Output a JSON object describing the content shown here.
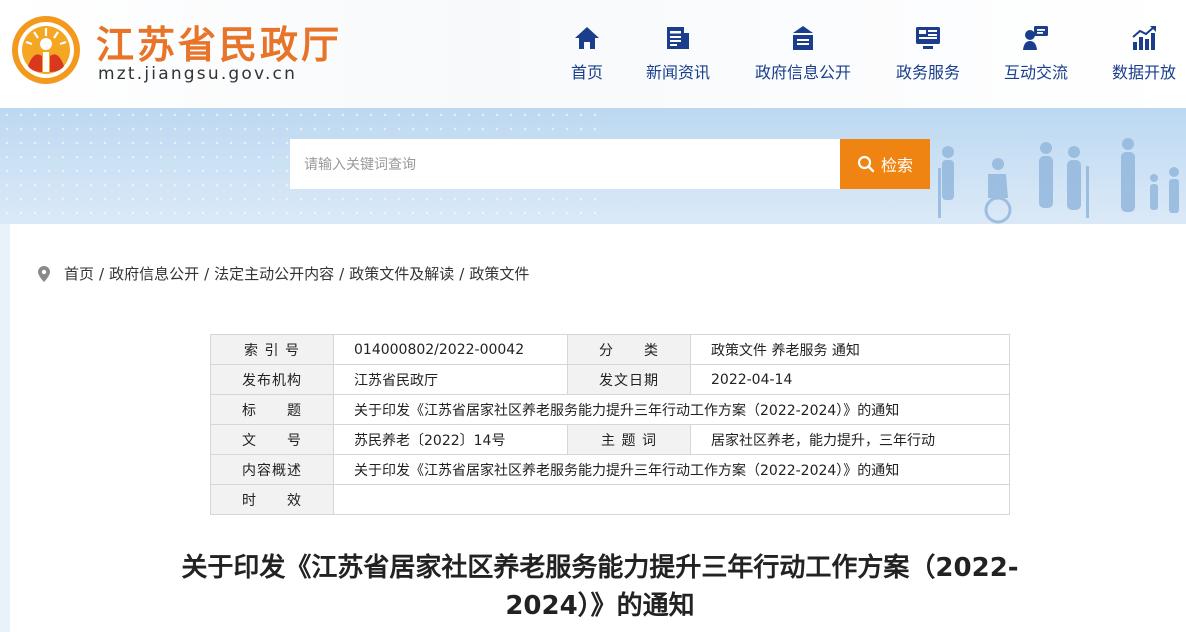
{
  "header": {
    "site_title": "江苏省民政厅",
    "domain": "mzt.jiangsu.gov.cn"
  },
  "nav": {
    "items": [
      {
        "label": "首页",
        "icon": "home-icon"
      },
      {
        "label": "新闻资讯",
        "icon": "news-icon"
      },
      {
        "label": "政府信息公开",
        "icon": "gov-info-icon"
      },
      {
        "label": "政务服务",
        "icon": "service-icon"
      },
      {
        "label": "互动交流",
        "icon": "interact-icon"
      },
      {
        "label": "数据开放",
        "icon": "data-icon"
      }
    ],
    "color": "#1a3e8c"
  },
  "search": {
    "placeholder": "请输入关键词查询",
    "button_label": "检索",
    "button_color": "#f08412"
  },
  "breadcrumb": {
    "items": [
      "首页",
      "政府信息公开",
      "法定主动公开内容",
      "政策文件及解读",
      "政策文件"
    ]
  },
  "meta": {
    "index_label": "索 引 号",
    "index_value": "014000802/2022-00042",
    "category_label": "分　　类",
    "category_value": "政策文件 养老服务 通知",
    "issuer_label": "发布机构",
    "issuer_value": "江苏省民政厅",
    "date_label": "发文日期",
    "date_value": "2022-04-14",
    "title_label": "标　　题",
    "title_value": "关于印发《江苏省居家社区养老服务能力提升三年行动工作方案（2022-2024）》的通知",
    "docno_label": "文　　号",
    "docno_value": "苏民养老〔2022〕14号",
    "subject_label": "主 题 词",
    "subject_value": "居家社区养老，能力提升，三年行动",
    "summary_label": "内容概述",
    "summary_value": "关于印发《江苏省居家社区养老服务能力提升三年行动工作方案（2022-2024）》的通知",
    "validity_label": "时　　效",
    "validity_value": ""
  },
  "article": {
    "title_line1": "关于印发《江苏省居家社区养老服务能力提升三年行动工作方案（2022-",
    "title_line2": "2024）》的通知"
  }
}
